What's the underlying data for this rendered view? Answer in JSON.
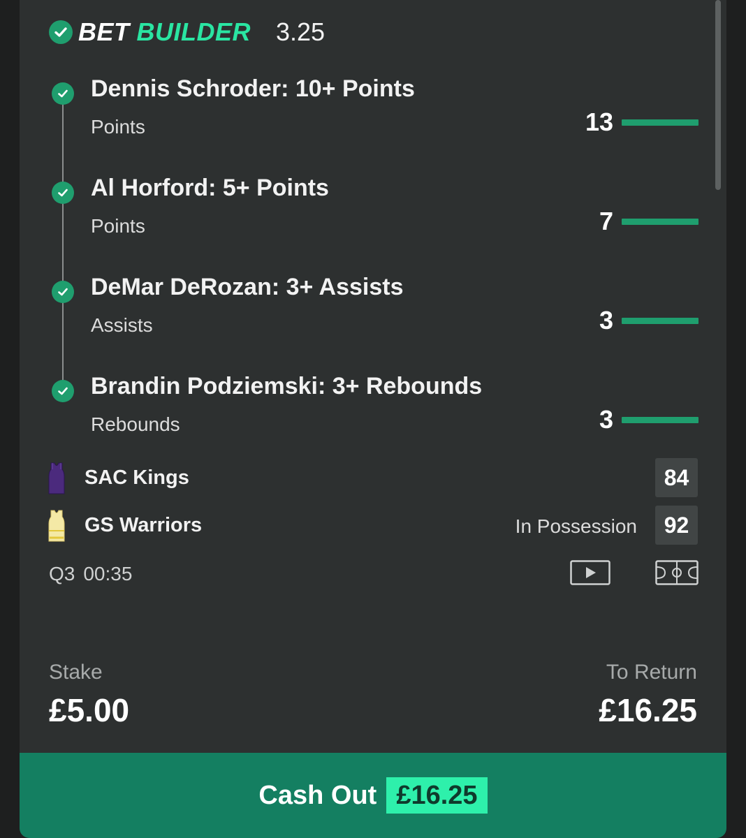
{
  "header": {
    "brand_part1": "BET",
    "brand_part2": "BUILDER",
    "odds": "3.25"
  },
  "legs": [
    {
      "title": "Dennis Schroder: 10+ Points",
      "market": "Points",
      "value": "13",
      "status": "won"
    },
    {
      "title": "Al Horford: 5+ Points",
      "market": "Points",
      "value": "7",
      "status": "won"
    },
    {
      "title": "DeMar DeRozan: 3+ Assists",
      "market": "Assists",
      "value": "3",
      "status": "won"
    },
    {
      "title": "Brandin Podziemski: 3+ Rebounds",
      "market": "Rebounds",
      "value": "3",
      "status": "won"
    }
  ],
  "match": {
    "home": {
      "name": "SAC Kings",
      "score": "84",
      "jersey_color": "#4b2a7d"
    },
    "away": {
      "name": "GS Warriors",
      "score": "92",
      "possession": "In Possession",
      "jersey_color": "#f4e9a6"
    },
    "period": "Q3",
    "clock": "00:35",
    "icons": [
      "play-video-icon",
      "court-tracker-icon"
    ]
  },
  "bet": {
    "stake_label": "Stake",
    "stake_value": "£5.00",
    "return_label": "To Return",
    "return_value": "£16.25"
  },
  "cashout": {
    "label": "Cash Out",
    "amount": "£16.25"
  },
  "colors": {
    "accent_green": "#1f9e6e",
    "bright_green": "#2ae5a2",
    "card_bg": "#2d3030"
  }
}
